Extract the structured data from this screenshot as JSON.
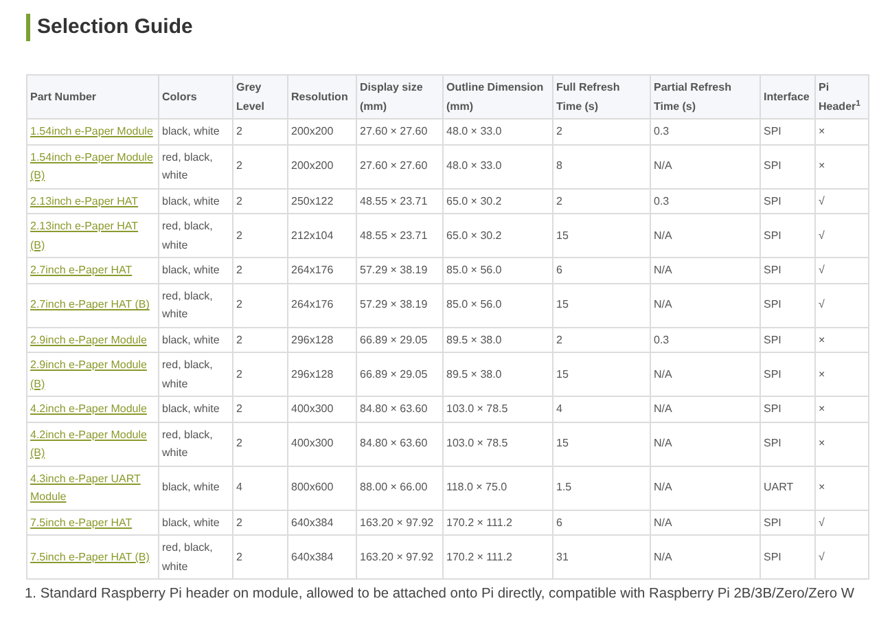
{
  "heading": "Selection Guide",
  "table": {
    "columns": [
      "Part Number",
      "Colors",
      "Grey Level",
      "Resolution",
      "Display size (mm)",
      "Outline Dimension (mm)",
      "Full Refresh Time (s)",
      "Partial Refresh Time (s)",
      "Interface",
      "Pi Header$^{1}$"
    ],
    "rows": [
      [
        "1.54inch e-Paper Module",
        "black, white",
        "2",
        "200x200",
        "27.60 × 27.60",
        "48.0 × 33.0",
        "2",
        "0.3",
        "SPI",
        "×"
      ],
      [
        "1.54inch e-Paper Module (B)",
        "red, black, white",
        "2",
        "200x200",
        "27.60 × 27.60",
        "48.0 × 33.0",
        "8",
        "N/A",
        "SPI",
        "×"
      ],
      [
        "2.13inch e-Paper HAT",
        "black, white",
        "2",
        "250x122",
        "48.55 × 23.71",
        "65.0 × 30.2",
        "2",
        "0.3",
        "SPI",
        "√"
      ],
      [
        "2.13inch e-Paper HAT (B)",
        "red, black, white",
        "2",
        "212x104",
        "48.55 × 23.71",
        "65.0 × 30.2",
        "15",
        "N/A",
        "SPI",
        "√"
      ],
      [
        "2.7inch e-Paper HAT",
        "black, white",
        "2",
        "264x176",
        "57.29 × 38.19",
        "85.0 × 56.0",
        "6",
        "N/A",
        "SPI",
        "√"
      ],
      [
        "2.7inch e-Paper HAT (B)",
        "red, black, white",
        "2",
        "264x176",
        "57.29 × 38.19",
        "85.0 × 56.0",
        "15",
        "N/A",
        "SPI",
        "√"
      ],
      [
        "2.9inch e-Paper Module",
        "black, white",
        "2",
        "296x128",
        "66.89 × 29.05",
        "89.5 × 38.0",
        "2",
        "0.3",
        "SPI",
        "×"
      ],
      [
        "2.9inch e-Paper Module (B)",
        "red, black, white",
        "2",
        "296x128",
        "66.89 × 29.05",
        "89.5 × 38.0",
        "15",
        "N/A",
        "SPI",
        "×"
      ],
      [
        "4.2inch e-Paper Module",
        "black, white",
        "2",
        "400x300",
        "84.80 × 63.60",
        "103.0 × 78.5",
        "4",
        "N/A",
        "SPI",
        "×"
      ],
      [
        "4.2inch e-Paper Module (B)",
        "red, black, white",
        "2",
        "400x300",
        "84.80 × 63.60",
        "103.0 × 78.5",
        "15",
        "N/A",
        "SPI",
        "×"
      ],
      [
        "4.3inch e-Paper UART Module",
        "black, white",
        "4",
        "800x600",
        "88.00 × 66.00",
        "118.0 × 75.0",
        "1.5",
        "N/A",
        "UART",
        "×"
      ],
      [
        "7.5inch e-Paper HAT",
        "black, white",
        "2",
        "640x384",
        "163.20 × 97.92",
        "170.2 × 111.2",
        "6",
        "N/A",
        "SPI",
        "√"
      ],
      [
        "7.5inch e-Paper HAT (B)",
        "red, black, white",
        "2",
        "640x384",
        "163.20 × 97.92",
        "170.2 × 111.2",
        "31",
        "N/A",
        "SPI",
        "√"
      ]
    ]
  },
  "footnote": "1. Standard Raspberry Pi header on module, allowed to be attached onto Pi directly, compatible with Raspberry Pi 2B/3B/Zero/Zero W"
}
